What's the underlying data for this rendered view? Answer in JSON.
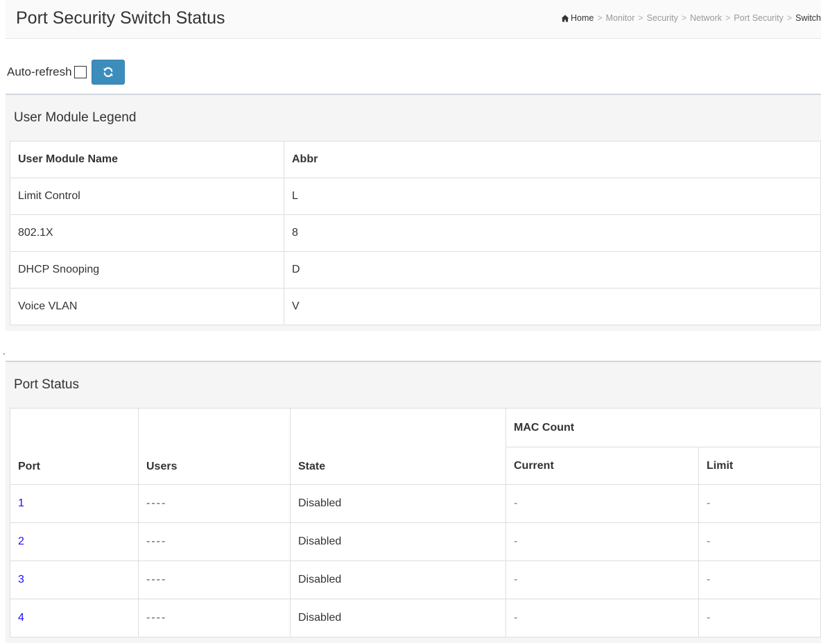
{
  "header": {
    "title": "Port Security Switch Status",
    "breadcrumb": [
      "Home",
      "Monitor",
      "Security",
      "Network",
      "Port Security",
      "Switch"
    ]
  },
  "toolbar": {
    "auto_refresh_label": "Auto-refresh",
    "auto_refresh_checked": false,
    "refresh_icon": "refresh-icon"
  },
  "legend": {
    "title": "User Module Legend",
    "columns": [
      "User Module Name",
      "Abbr"
    ],
    "rows": [
      [
        "Limit Control",
        "L"
      ],
      [
        "802.1X",
        "8"
      ],
      [
        "DHCP Snooping",
        "D"
      ],
      [
        "Voice VLAN",
        "V"
      ]
    ]
  },
  "separator_text": ".",
  "port_status": {
    "title": "Port Status",
    "columns": {
      "port": "Port",
      "users": "Users",
      "state": "State",
      "mac_count": "MAC Count",
      "current": "Current",
      "limit": "Limit"
    },
    "rows": [
      {
        "port": "1",
        "users": "----",
        "state": "Disabled",
        "current": "-",
        "limit": "-"
      },
      {
        "port": "2",
        "users": "----",
        "state": "Disabled",
        "current": "-",
        "limit": "-"
      },
      {
        "port": "3",
        "users": "----",
        "state": "Disabled",
        "current": "-",
        "limit": "-"
      },
      {
        "port": "4",
        "users": "----",
        "state": "Disabled",
        "current": "-",
        "limit": "-"
      }
    ]
  },
  "colors": {
    "accent": "#3c8dbc",
    "link": "#1a0dff"
  }
}
